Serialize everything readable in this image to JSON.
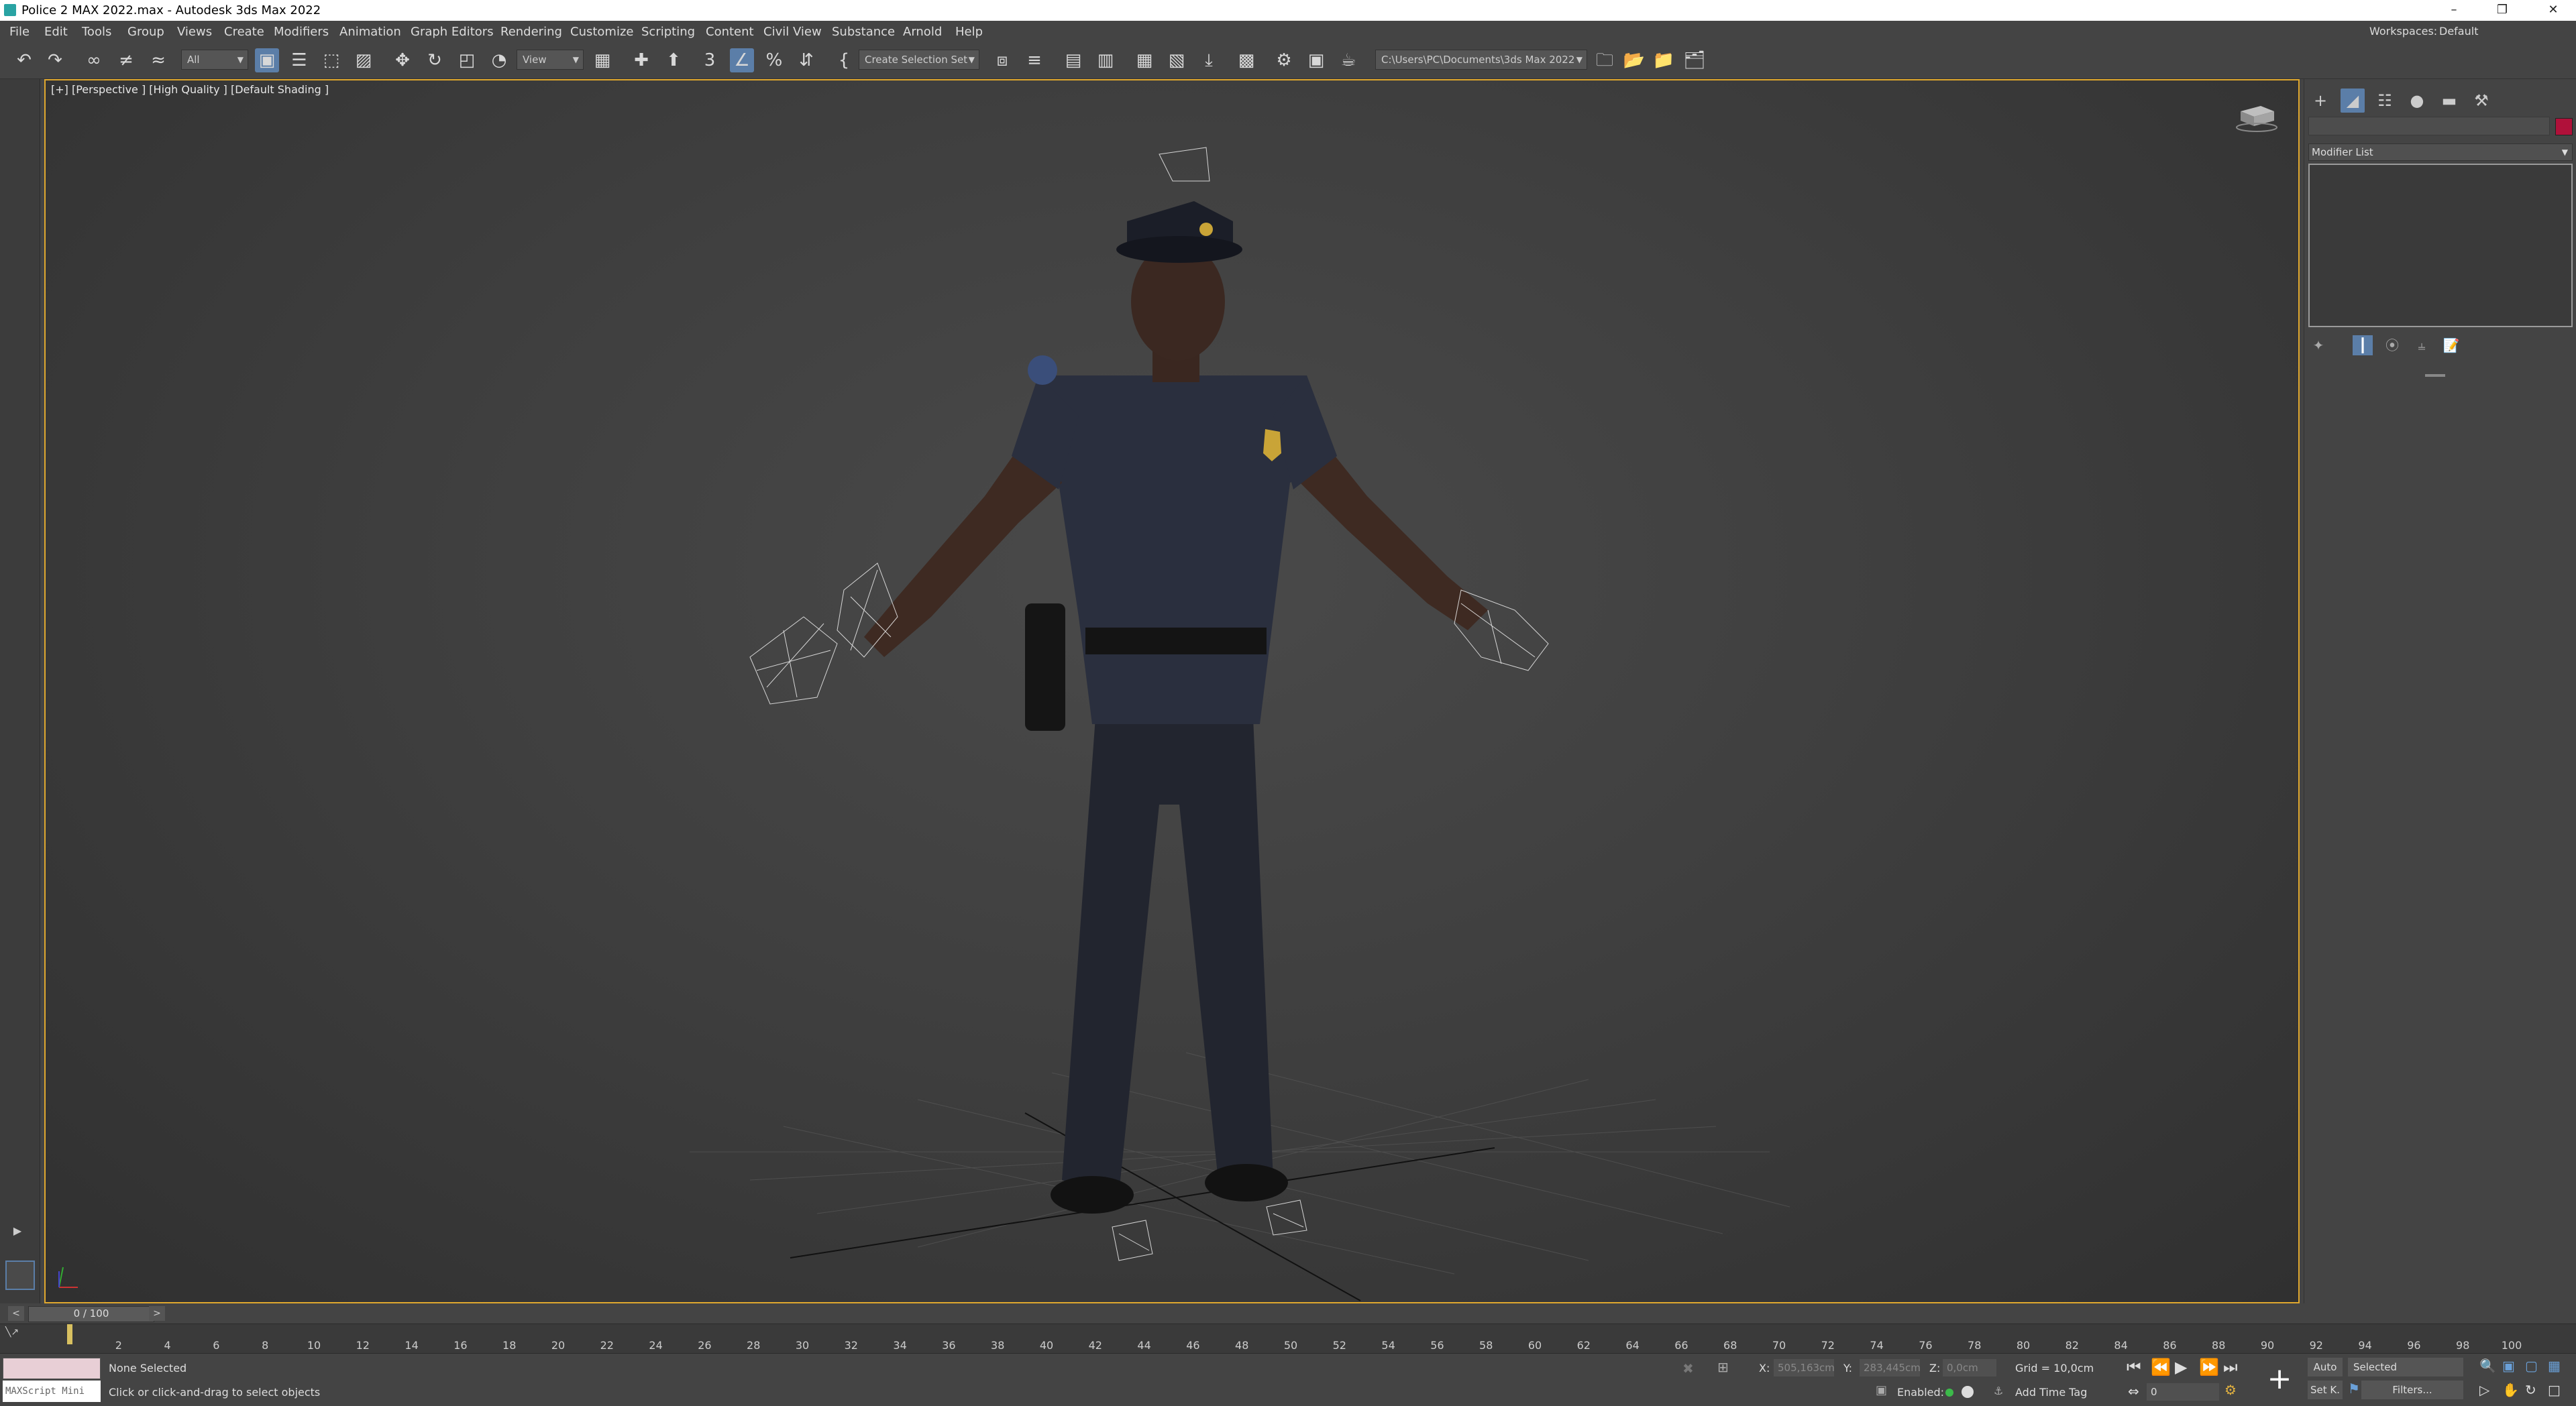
{
  "window": {
    "title": "Police 2 MAX 2022.max - Autodesk 3ds Max 2022"
  },
  "menu": {
    "items": [
      "File",
      "Edit",
      "Tools",
      "Group",
      "Views",
      "Create",
      "Modifiers",
      "Animation",
      "Graph Editors",
      "Rendering",
      "Customize",
      "Scripting",
      "Content",
      "Civil View",
      "Substance",
      "Arnold",
      "Help"
    ],
    "workspaces_label": "Workspaces:",
    "workspaces_value": "Default"
  },
  "toolbar": {
    "selection_filter": "All",
    "ref_coord": "View",
    "named_selection_placeholder": "Create Selection Set",
    "snap_label": "3",
    "project_path": "C:\\Users\\PC\\Documents\\3ds Max 2022"
  },
  "viewport": {
    "label": "[+] [Perspective ] [High Quality ] [Default Shading ]"
  },
  "command_panel": {
    "modifier_list": "Modifier List",
    "object_color": "#b0113a"
  },
  "timeline": {
    "frame_display": "0 / 100",
    "ticks": [
      "2",
      "4",
      "6",
      "8",
      "10",
      "12",
      "14",
      "16",
      "18",
      "20",
      "22",
      "24",
      "26",
      "28",
      "30",
      "32",
      "34",
      "36",
      "38",
      "40",
      "42",
      "44",
      "46",
      "48",
      "50",
      "52",
      "54",
      "56",
      "58",
      "60",
      "62",
      "64",
      "66",
      "68",
      "70",
      "72",
      "74",
      "76",
      "78",
      "80",
      "82",
      "84",
      "86",
      "88",
      "90",
      "92",
      "94",
      "96",
      "98",
      "100"
    ]
  },
  "status": {
    "maxscript_label": "MAXScript Mini",
    "selection": "None Selected",
    "prompt": "Click or click-and-drag to select objects",
    "x_label": "X:",
    "x_value": "505,163cm",
    "y_label": "Y:",
    "y_value": "283,445cm",
    "z_label": "Z:",
    "z_value": "0,0cm",
    "grid": "Grid = 10,0cm",
    "enabled_label": "Enabled:",
    "add_time_tag": "Add Time Tag",
    "auto_label": "Auto",
    "selected_label": "Selected",
    "setk_label": "Set K.",
    "filters_label": "Filters...",
    "current_frame": "0"
  }
}
